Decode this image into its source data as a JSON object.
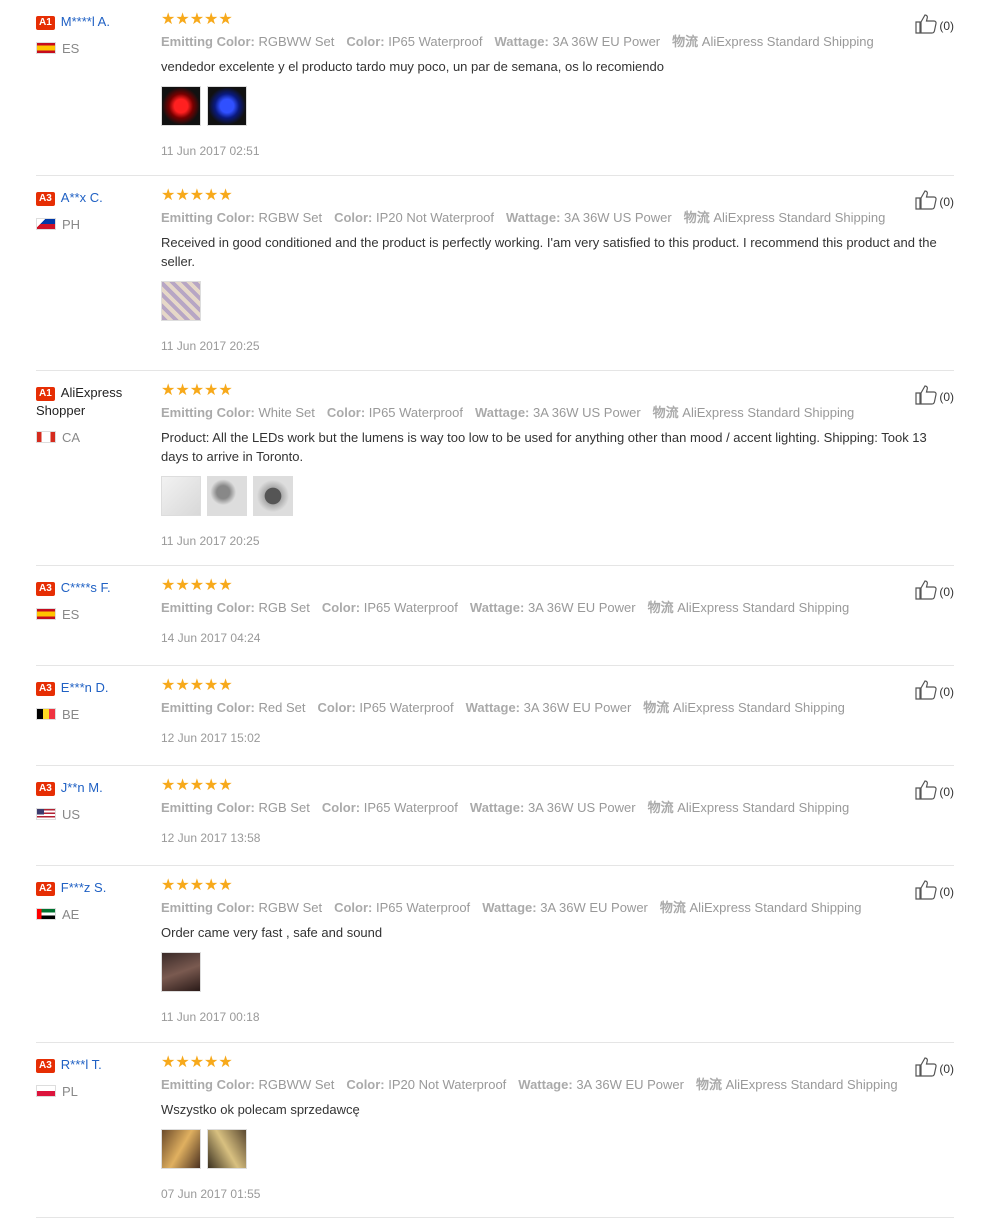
{
  "colors": {
    "accent": "#f7a91b",
    "name_link": "#2061c4",
    "badge": "#e62e04"
  },
  "reviews": [
    {
      "badge": "A1",
      "name": "M****l A.",
      "name_link": true,
      "country": "ES",
      "flag": "es",
      "stars": "★★★★★",
      "attrs": [
        {
          "k": "Emitting Color:",
          "v": "RGBWW Set"
        },
        {
          "k": "Color:",
          "v": "IP65 Waterproof"
        },
        {
          "k": "Wattage:",
          "v": "3A 36W EU Power"
        },
        {
          "k": "物流",
          "v": "AliExpress Standard Shipping"
        }
      ],
      "text": "vendedor excelente y el producto tardo muy poco, un par de semana, os lo recomiendo",
      "images": [
        "red-led-photo",
        "blue-led-photo"
      ],
      "date": "11 Jun 2017 02:51",
      "likes": "(0)"
    },
    {
      "badge": "A3",
      "name": "A**x C.",
      "name_link": true,
      "country": "PH",
      "flag": "ph",
      "stars": "★★★★★",
      "attrs": [
        {
          "k": "Emitting Color:",
          "v": "RGBW Set"
        },
        {
          "k": "Color:",
          "v": "IP20 Not Waterproof"
        },
        {
          "k": "Wattage:",
          "v": "3A 36W US Power"
        },
        {
          "k": "物流",
          "v": "AliExpress Standard Shipping"
        }
      ],
      "text": "Received in good conditioned and the product is perfectly working. I'am very satisfied to this product. I recommend this product and the seller.",
      "images": [
        "led-package-photo"
      ],
      "date": "11 Jun 2017 20:25",
      "likes": "(0)"
    },
    {
      "badge": "A1",
      "name": "AliExpress Shopper",
      "name_link": false,
      "country": "CA",
      "flag": "ca",
      "stars": "★★★★★",
      "attrs": [
        {
          "k": "Emitting Color:",
          "v": "White Set"
        },
        {
          "k": "Color:",
          "v": "IP65 Waterproof"
        },
        {
          "k": "Wattage:",
          "v": "3A 36W US Power"
        },
        {
          "k": "物流",
          "v": "AliExpress Standard Shipping"
        }
      ],
      "text": "Product: All the LEDs work but the lumens is way too low to be used for anything other than mood / accent lighting. Shipping: Took 13 days to arrive in Toronto.",
      "images": [
        "white-strip-photo",
        "power-adapter-photo",
        "led-reel-photo"
      ],
      "date": "11 Jun 2017 20:25",
      "likes": "(0)"
    },
    {
      "badge": "A3",
      "name": "C****s F.",
      "name_link": true,
      "country": "ES",
      "flag": "es",
      "stars": "★★★★★",
      "attrs": [
        {
          "k": "Emitting Color:",
          "v": "RGB Set"
        },
        {
          "k": "Color:",
          "v": "IP65 Waterproof"
        },
        {
          "k": "Wattage:",
          "v": "3A 36W EU Power"
        },
        {
          "k": "物流",
          "v": "AliExpress Standard Shipping"
        }
      ],
      "text": "",
      "images": [],
      "date": "14 Jun 2017 04:24",
      "likes": "(0)"
    },
    {
      "badge": "A3",
      "name": "E***n D.",
      "name_link": true,
      "country": "BE",
      "flag": "be",
      "stars": "★★★★★",
      "attrs": [
        {
          "k": "Emitting Color:",
          "v": "Red Set"
        },
        {
          "k": "Color:",
          "v": "IP65 Waterproof"
        },
        {
          "k": "Wattage:",
          "v": "3A 36W EU Power"
        },
        {
          "k": "物流",
          "v": "AliExpress Standard Shipping"
        }
      ],
      "text": "",
      "images": [],
      "date": "12 Jun 2017 15:02",
      "likes": "(0)"
    },
    {
      "badge": "A3",
      "name": "J**n M.",
      "name_link": true,
      "country": "US",
      "flag": "us",
      "stars": "★★★★★",
      "attrs": [
        {
          "k": "Emitting Color:",
          "v": "RGB Set"
        },
        {
          "k": "Color:",
          "v": "IP65 Waterproof"
        },
        {
          "k": "Wattage:",
          "v": "3A 36W US Power"
        },
        {
          "k": "物流",
          "v": "AliExpress Standard Shipping"
        }
      ],
      "text": "",
      "images": [],
      "date": "12 Jun 2017 13:58",
      "likes": "(0)"
    },
    {
      "badge": "A2",
      "name": "F***z S.",
      "name_link": true,
      "country": "AE",
      "flag": "ae",
      "stars": "★★★★★",
      "attrs": [
        {
          "k": "Emitting Color:",
          "v": "RGBW Set"
        },
        {
          "k": "Color:",
          "v": "IP65 Waterproof"
        },
        {
          "k": "Wattage:",
          "v": "3A 36W EU Power"
        },
        {
          "k": "物流",
          "v": "AliExpress Standard Shipping"
        }
      ],
      "text": "Order came very fast , safe and sound",
      "images": [
        "led-strip-night-photo"
      ],
      "date": "11 Jun 2017 00:18",
      "likes": "(0)"
    },
    {
      "badge": "A3",
      "name": "R***l T.",
      "name_link": true,
      "country": "PL",
      "flag": "pl",
      "stars": "★★★★★",
      "attrs": [
        {
          "k": "Emitting Color:",
          "v": "RGBWW Set"
        },
        {
          "k": "Color:",
          "v": "IP20 Not Waterproof"
        },
        {
          "k": "Wattage:",
          "v": "3A 36W EU Power"
        },
        {
          "k": "物流",
          "v": "AliExpress Standard Shipping"
        }
      ],
      "text": "Wszystko ok polecam sprzedawcę",
      "images": [
        "installed-strip-photo",
        "wall-light-photo"
      ],
      "date": "07 Jun 2017 01:55",
      "likes": "(0)"
    }
  ]
}
